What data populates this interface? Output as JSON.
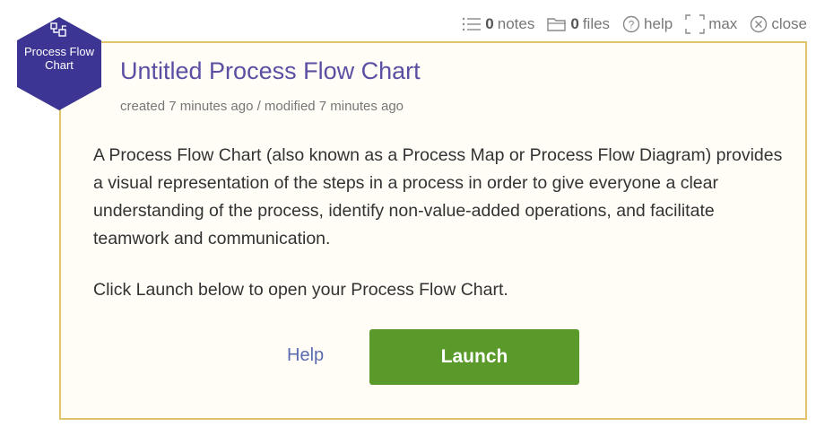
{
  "toolbar": {
    "notes_count": "0",
    "notes_label": "notes",
    "files_count": "0",
    "files_label": "files",
    "help_label": "help",
    "max_label": "max",
    "close_label": "close"
  },
  "badge": {
    "line1": "Process Flow",
    "line2": "Chart",
    "icon": "flow-chart-icon",
    "color": "#3d3593"
  },
  "document": {
    "title": "Untitled Process Flow Chart",
    "meta": "created 7 minutes ago / modified 7 minutes ago",
    "description": "A Process Flow Chart (also known as a Process Map or Process Flow Diagram) provides a visual representation of the steps in a process in order to give everyone a clear understanding of the process, identify non-value-added operations, and facilitate teamwork and communication.",
    "instruction": "Click Launch below to open your Process Flow Chart."
  },
  "actions": {
    "help_label": "Help",
    "launch_label": "Launch"
  },
  "colors": {
    "accent": "#5b4fa3",
    "launch": "#5a9a2b",
    "card_border": "#e0c46c"
  }
}
